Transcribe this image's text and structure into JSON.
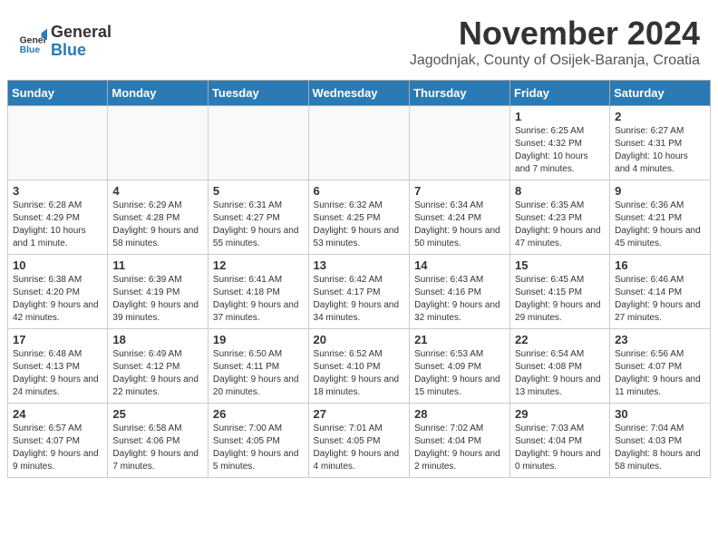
{
  "header": {
    "logo_general": "General",
    "logo_blue": "Blue",
    "month_title": "November 2024",
    "subtitle": "Jagodnjak, County of Osijek-Baranja, Croatia"
  },
  "columns": [
    "Sunday",
    "Monday",
    "Tuesday",
    "Wednesday",
    "Thursday",
    "Friday",
    "Saturday"
  ],
  "weeks": [
    [
      {
        "day": "",
        "info": ""
      },
      {
        "day": "",
        "info": ""
      },
      {
        "day": "",
        "info": ""
      },
      {
        "day": "",
        "info": ""
      },
      {
        "day": "",
        "info": ""
      },
      {
        "day": "1",
        "info": "Sunrise: 6:25 AM\nSunset: 4:32 PM\nDaylight: 10 hours and 7 minutes."
      },
      {
        "day": "2",
        "info": "Sunrise: 6:27 AM\nSunset: 4:31 PM\nDaylight: 10 hours and 4 minutes."
      }
    ],
    [
      {
        "day": "3",
        "info": "Sunrise: 6:28 AM\nSunset: 4:29 PM\nDaylight: 10 hours and 1 minute."
      },
      {
        "day": "4",
        "info": "Sunrise: 6:29 AM\nSunset: 4:28 PM\nDaylight: 9 hours and 58 minutes."
      },
      {
        "day": "5",
        "info": "Sunrise: 6:31 AM\nSunset: 4:27 PM\nDaylight: 9 hours and 55 minutes."
      },
      {
        "day": "6",
        "info": "Sunrise: 6:32 AM\nSunset: 4:25 PM\nDaylight: 9 hours and 53 minutes."
      },
      {
        "day": "7",
        "info": "Sunrise: 6:34 AM\nSunset: 4:24 PM\nDaylight: 9 hours and 50 minutes."
      },
      {
        "day": "8",
        "info": "Sunrise: 6:35 AM\nSunset: 4:23 PM\nDaylight: 9 hours and 47 minutes."
      },
      {
        "day": "9",
        "info": "Sunrise: 6:36 AM\nSunset: 4:21 PM\nDaylight: 9 hours and 45 minutes."
      }
    ],
    [
      {
        "day": "10",
        "info": "Sunrise: 6:38 AM\nSunset: 4:20 PM\nDaylight: 9 hours and 42 minutes."
      },
      {
        "day": "11",
        "info": "Sunrise: 6:39 AM\nSunset: 4:19 PM\nDaylight: 9 hours and 39 minutes."
      },
      {
        "day": "12",
        "info": "Sunrise: 6:41 AM\nSunset: 4:18 PM\nDaylight: 9 hours and 37 minutes."
      },
      {
        "day": "13",
        "info": "Sunrise: 6:42 AM\nSunset: 4:17 PM\nDaylight: 9 hours and 34 minutes."
      },
      {
        "day": "14",
        "info": "Sunrise: 6:43 AM\nSunset: 4:16 PM\nDaylight: 9 hours and 32 minutes."
      },
      {
        "day": "15",
        "info": "Sunrise: 6:45 AM\nSunset: 4:15 PM\nDaylight: 9 hours and 29 minutes."
      },
      {
        "day": "16",
        "info": "Sunrise: 6:46 AM\nSunset: 4:14 PM\nDaylight: 9 hours and 27 minutes."
      }
    ],
    [
      {
        "day": "17",
        "info": "Sunrise: 6:48 AM\nSunset: 4:13 PM\nDaylight: 9 hours and 24 minutes."
      },
      {
        "day": "18",
        "info": "Sunrise: 6:49 AM\nSunset: 4:12 PM\nDaylight: 9 hours and 22 minutes."
      },
      {
        "day": "19",
        "info": "Sunrise: 6:50 AM\nSunset: 4:11 PM\nDaylight: 9 hours and 20 minutes."
      },
      {
        "day": "20",
        "info": "Sunrise: 6:52 AM\nSunset: 4:10 PM\nDaylight: 9 hours and 18 minutes."
      },
      {
        "day": "21",
        "info": "Sunrise: 6:53 AM\nSunset: 4:09 PM\nDaylight: 9 hours and 15 minutes."
      },
      {
        "day": "22",
        "info": "Sunrise: 6:54 AM\nSunset: 4:08 PM\nDaylight: 9 hours and 13 minutes."
      },
      {
        "day": "23",
        "info": "Sunrise: 6:56 AM\nSunset: 4:07 PM\nDaylight: 9 hours and 11 minutes."
      }
    ],
    [
      {
        "day": "24",
        "info": "Sunrise: 6:57 AM\nSunset: 4:07 PM\nDaylight: 9 hours and 9 minutes."
      },
      {
        "day": "25",
        "info": "Sunrise: 6:58 AM\nSunset: 4:06 PM\nDaylight: 9 hours and 7 minutes."
      },
      {
        "day": "26",
        "info": "Sunrise: 7:00 AM\nSunset: 4:05 PM\nDaylight: 9 hours and 5 minutes."
      },
      {
        "day": "27",
        "info": "Sunrise: 7:01 AM\nSunset: 4:05 PM\nDaylight: 9 hours and 4 minutes."
      },
      {
        "day": "28",
        "info": "Sunrise: 7:02 AM\nSunset: 4:04 PM\nDaylight: 9 hours and 2 minutes."
      },
      {
        "day": "29",
        "info": "Sunrise: 7:03 AM\nSunset: 4:04 PM\nDaylight: 9 hours and 0 minutes."
      },
      {
        "day": "30",
        "info": "Sunrise: 7:04 AM\nSunset: 4:03 PM\nDaylight: 8 hours and 58 minutes."
      }
    ]
  ]
}
